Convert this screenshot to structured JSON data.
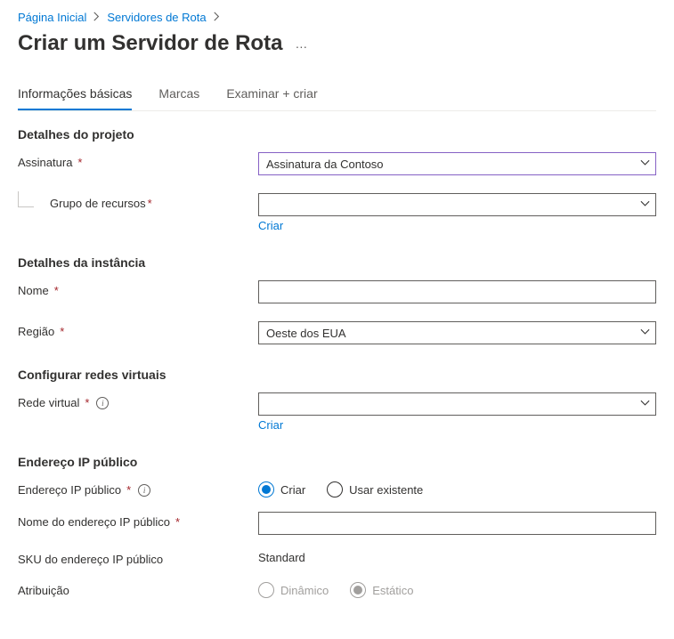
{
  "breadcrumb": {
    "home": "Página Inicial",
    "routeServers": "Servidores de Rota"
  },
  "page": {
    "title": "Criar um Servidor de Rota"
  },
  "tabs": {
    "basics": "Informações básicas",
    "tags": "Marcas",
    "review": "Examinar + criar"
  },
  "sections": {
    "projectDetails": "Detalhes do projeto",
    "instanceDetails": "Detalhes da instância",
    "virtualNetworks": "Configurar redes virtuais",
    "publicIp": "Endereço IP público"
  },
  "labels": {
    "subscription": "Assinatura",
    "resourceGroup": "Grupo de recursos",
    "name": "Nome",
    "region": "Região",
    "virtualNetwork": "Rede virtual",
    "publicIpAddress": "Endereço IP público",
    "publicIpName": "Nome do endereço IP público",
    "publicIpSku": "SKU do endereço IP público",
    "assignment": "Atribuição"
  },
  "values": {
    "subscription": "Assinatura da Contoso",
    "resourceGroup": "",
    "name": "",
    "region": "Oeste dos EUA",
    "virtualNetwork": "",
    "publicIpSku": "Standard"
  },
  "links": {
    "createNew": "Criar"
  },
  "radios": {
    "createNew": "Criar",
    "useExisting": "Usar existente",
    "dynamic": "Dinâmico",
    "static": "Estático"
  }
}
